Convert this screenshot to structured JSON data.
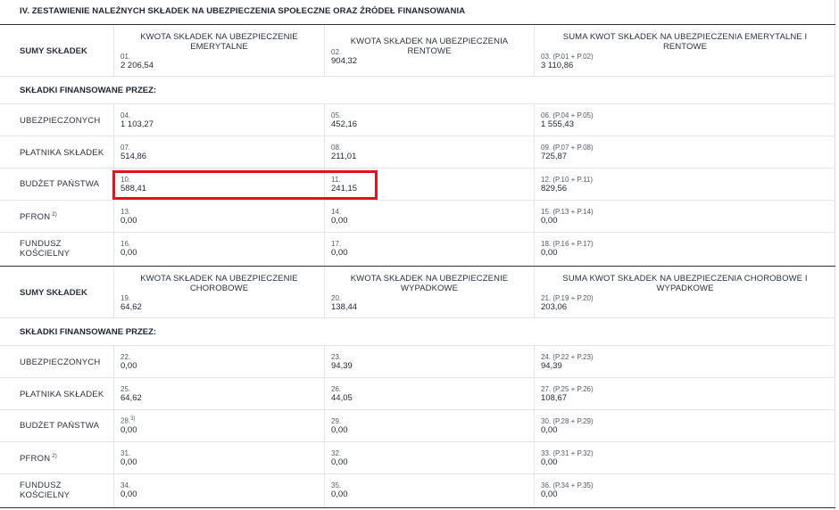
{
  "section_title": "IV. ZESTAWIENIE NALEŻNYCH SKŁADEK NA UBEZPIECZENIA SPOŁECZNE ORAZ ŹRÓDEŁ FINANSOWANIA",
  "part1": {
    "sums_label": "SUMY SKŁADEK",
    "col1_head": "KWOTA SKŁADEK NA UBEZPIECZENIE EMERYTALNE",
    "col2_head": "KWOTA SKŁADEK NA UBEZPIECZENIA RENTOWE",
    "col3_head": "SUMA KWOT SKŁADEK NA UBEZPIECZENIA EMERYTALNE I RENTOWE",
    "sums": [
      {
        "num": "01.",
        "val": "2 206,54"
      },
      {
        "num": "02.",
        "val": "904,32"
      },
      {
        "num": "03. (P.01 + P.02)",
        "val": "3 110,86"
      }
    ],
    "financed_label": "SKŁADKI FINANSOWANE PRZEZ:",
    "rows": [
      {
        "label": "UBEZPIECZONYCH",
        "cells": [
          {
            "num": "04.",
            "val": "1 103,27"
          },
          {
            "num": "05.",
            "val": "452,16"
          },
          {
            "num": "06. (P.04 + P.05)",
            "val": "1 555,43"
          }
        ]
      },
      {
        "label": "PŁATNIKA SKŁADEK",
        "cells": [
          {
            "num": "07.",
            "val": "514,86"
          },
          {
            "num": "08.",
            "val": "211,01"
          },
          {
            "num": "09. (P.07 + P.08)",
            "val": "725,87"
          }
        ]
      },
      {
        "label": "BUDŻET PAŃSTWA",
        "cells": [
          {
            "num": "10.",
            "val": "588,41"
          },
          {
            "num": "11.",
            "val": "241,15"
          },
          {
            "num": "12. (P.10 + P.11)",
            "val": "829,56"
          }
        ]
      },
      {
        "label": "PFRON",
        "sup": "2)",
        "cells": [
          {
            "num": "13.",
            "val": "0,00"
          },
          {
            "num": "14.",
            "val": "0,00"
          },
          {
            "num": "15. (P.13 + P.14)",
            "val": "0,00"
          }
        ]
      },
      {
        "label1": "FUNDUSZ",
        "label2": "KOŚCIELNY",
        "cells": [
          {
            "num": "16.",
            "val": "0,00"
          },
          {
            "num": "17.",
            "val": "0,00"
          },
          {
            "num": "18. (P.16 + P.17)",
            "val": "0,00"
          }
        ]
      }
    ]
  },
  "part2": {
    "sums_label": "SUMY SKŁADEK",
    "col1_head": "KWOTA SKŁADEK NA UBEZPIECZENIE CHOROBOWE",
    "col2_head": "KWOTA SKŁADEK NA UBEZPIECZENIE WYPADKOWE",
    "col3_head": "SUMA KWOT SKŁADEK NA UBEZPIECZENIA CHOROBOWE I WYPADKOWE",
    "sums": [
      {
        "num": "19.",
        "val": "64,62"
      },
      {
        "num": "20.",
        "val": "138,44"
      },
      {
        "num": "21. (P.19 + P.20)",
        "val": "203,06"
      }
    ],
    "financed_label": "SKŁADKI FINANSOWANE PRZEZ:",
    "rows": [
      {
        "label": "UBEZPIECZONYCH",
        "cells": [
          {
            "num": "22.",
            "val": "0,00"
          },
          {
            "num": "23.",
            "val": "94,39"
          },
          {
            "num": "24. (P.22 + P.23)",
            "val": "94,39"
          }
        ]
      },
      {
        "label": "PŁATNIKA SKŁADEK",
        "cells": [
          {
            "num": "25.",
            "val": "64,62"
          },
          {
            "num": "26.",
            "val": "44,05"
          },
          {
            "num": "27. (P.25 + P.26)",
            "val": "108,67"
          }
        ]
      },
      {
        "label": "BUDŻET PAŃSTWA",
        "cells": [
          {
            "num": "28.",
            "sup": "3)",
            "val": "0,00"
          },
          {
            "num": "29.",
            "val": "0,00"
          },
          {
            "num": "30. (P.28 + P.29)",
            "val": "0,00"
          }
        ]
      },
      {
        "label": "PFRON",
        "sup": "2)",
        "cells": [
          {
            "num": "31.",
            "val": "0,00"
          },
          {
            "num": "32.",
            "val": "0,00"
          },
          {
            "num": "33. (P.31 + P.32)",
            "val": "0,00"
          }
        ]
      },
      {
        "label1": "FUNDUSZ",
        "label2": "KOŚCIELNY",
        "cells": [
          {
            "num": "34.",
            "val": "0,00"
          },
          {
            "num": "35.",
            "val": "0,00"
          },
          {
            "num": "36. (P.34 + P.35)",
            "val": "0,00"
          }
        ]
      }
    ]
  },
  "highlight_color": "#e0121c"
}
